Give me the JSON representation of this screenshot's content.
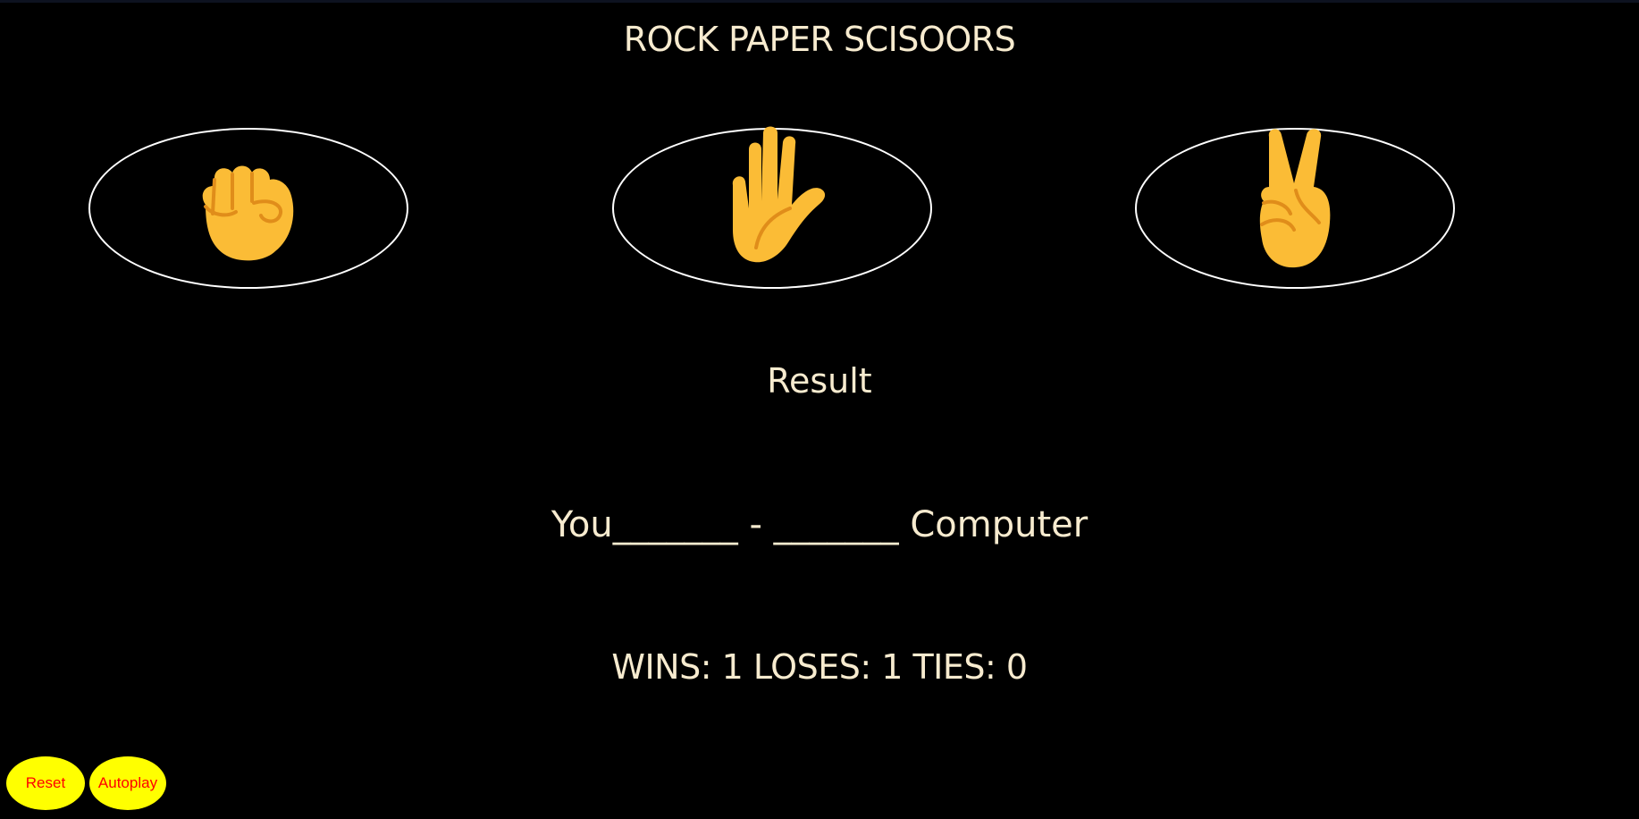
{
  "title": "ROCK PAPER SCISOORS",
  "moves": [
    {
      "name": "rock",
      "icon": "raised-fist-icon"
    },
    {
      "name": "paper",
      "icon": "raised-hand-icon"
    },
    {
      "name": "scissors",
      "icon": "victory-hand-icon"
    }
  ],
  "result_text": "Result",
  "moves_text": "You_______ - _______ Computer",
  "score_text": "WINS: 1 LOSES: 1 TIES: 0",
  "score": {
    "wins": 1,
    "loses": 1,
    "ties": 0
  },
  "controls": {
    "reset_label": "Reset",
    "autoplay_label": "Autoplay"
  },
  "colors": {
    "background": "#000000",
    "text": "#f7ebcf",
    "oval_border": "#ffffff",
    "control_bg": "#ffff00",
    "control_text": "#ff0000",
    "emoji_skin": "#fbbc36",
    "emoji_line": "#e08d1a"
  }
}
